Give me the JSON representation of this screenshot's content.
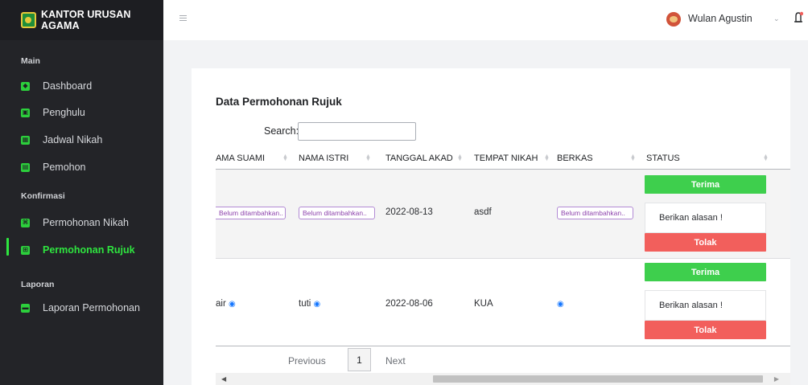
{
  "brand": {
    "name": "KANTOR URUSAN AGAMA",
    "logo_icon": "kua-logo-icon"
  },
  "sidebar": {
    "section_main": "Main",
    "section_konfirmasi": "Konfirmasi",
    "section_laporan": "Laporan",
    "items": [
      {
        "label": "Dashboard",
        "icon": "dashboard-icon"
      },
      {
        "label": "Penghulu",
        "icon": "id-card-icon"
      },
      {
        "label": "Jadwal Nikah",
        "icon": "calendar-icon"
      },
      {
        "label": "Pemohon",
        "icon": "user-card-icon"
      },
      {
        "label": "Permohonan Nikah",
        "icon": "command-icon"
      },
      {
        "label": "Permohonan Rujuk",
        "icon": "sitemap-icon",
        "active": true
      },
      {
        "label": "Laporan Permohonan",
        "icon": "print-icon"
      }
    ],
    "accent_color": "#2ee53f"
  },
  "topbar": {
    "menu_icon": "hamburger-icon",
    "user_name": "Wulan Agustin",
    "caret": "⌄",
    "notification_icon": "bell-icon"
  },
  "main": {
    "title": "Data Permohonan Rujuk",
    "search_label": "Search:",
    "search_value": "",
    "columns": [
      "NAMA SUAMI",
      "NAMA ISTRI",
      "TANGGAL AKAD",
      "TEMPAT NIKAH",
      "BERKAS",
      "STATUS"
    ],
    "rows": [
      {
        "nama_suami": "Belum ditambahkan..",
        "nama_istri": "Belum ditambahkan..",
        "tanggal_akad": "2022-08-13",
        "tempat_nikah": "asdf",
        "berkas": "Belum ditambahkan..",
        "accept_label": "Terima",
        "reason_placeholder": "Berikan alasan !",
        "reject_label": "Tolak"
      },
      {
        "nama_suami": "air",
        "nama_istri": "tuti",
        "tanggal_akad": "2022-08-06",
        "tempat_nikah": "KUA",
        "berkas": "",
        "accept_label": "Terima",
        "reason_placeholder": "Berikan alasan !",
        "reject_label": "Tolak"
      }
    ],
    "pagination": {
      "previous": "Previous",
      "current_page": "1",
      "next": "Next"
    },
    "colors": {
      "accept": "#3ecf4d",
      "reject": "#f25f5c",
      "badge": "#8e44ad",
      "eye": "#1677ff"
    }
  }
}
